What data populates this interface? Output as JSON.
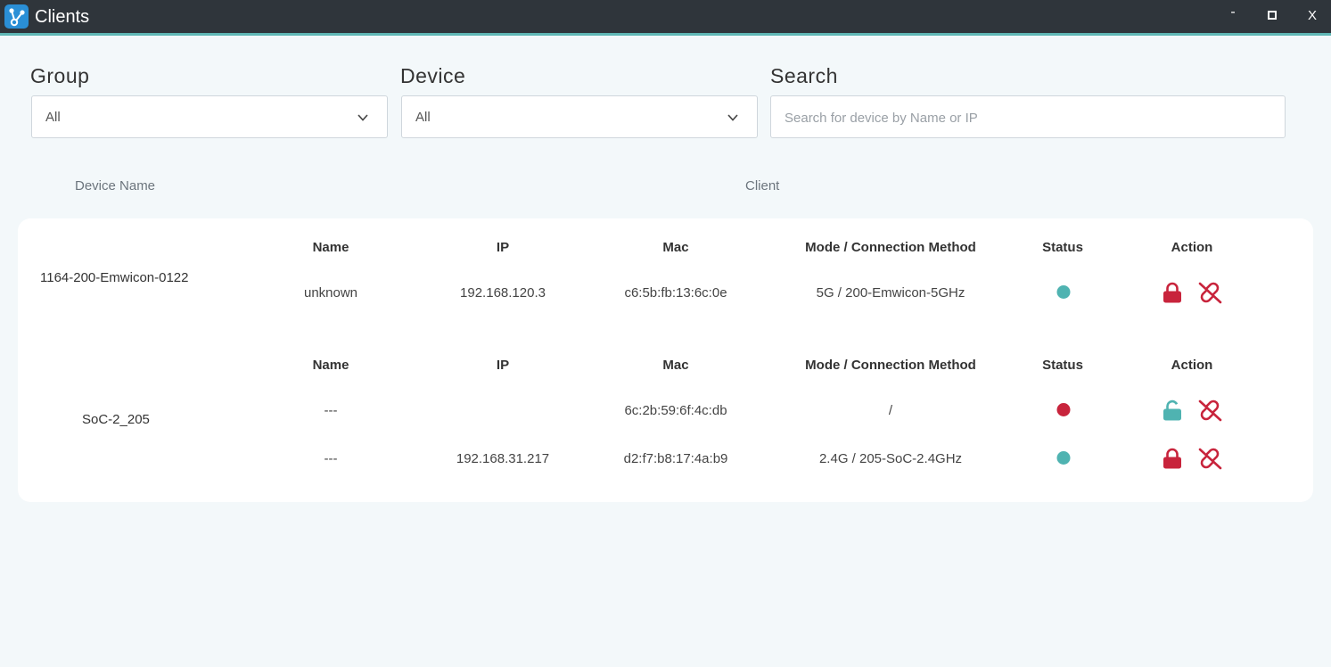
{
  "window": {
    "title": "Clients",
    "minimize": "-",
    "close": "X"
  },
  "filters": {
    "group": {
      "label": "Group",
      "value": "All"
    },
    "device": {
      "label": "Device",
      "value": "All"
    },
    "search": {
      "label": "Search",
      "placeholder": "Search for device by Name or IP"
    }
  },
  "columns": {
    "device_name": "Device Name",
    "client": "Client"
  },
  "table_headers": {
    "name": "Name",
    "ip": "IP",
    "mac": "Mac",
    "mode": "Mode / Connection Method",
    "status": "Status",
    "action": "Action"
  },
  "colors": {
    "status_online": "#4fb3b1",
    "status_offline": "#c8243c",
    "lock_red": "#c8243c",
    "lock_teal": "#4fb3b1"
  },
  "devices": [
    {
      "name": "1164-200-Emwicon-0122",
      "clients": [
        {
          "name": "unknown",
          "ip": "192.168.120.3",
          "mac": "c6:5b:fb:13:6c:0e",
          "mode": "5G / 200-Emwicon-5GHz",
          "status": "online",
          "lock": "locked-lock-icon"
        }
      ]
    },
    {
      "name": "SoC-2_205",
      "clients": [
        {
          "name": "---",
          "ip": "",
          "mac": "6c:2b:59:6f:4c:db",
          "mode": "/",
          "status": "offline",
          "lock": "unlocked-lock-icon"
        },
        {
          "name": "---",
          "ip": "192.168.31.217",
          "mac": "d2:f7:b8:17:4a:b9",
          "mode": "2.4G / 205-SoC-2.4GHz",
          "status": "online",
          "lock": "locked-lock-icon"
        }
      ]
    }
  ]
}
